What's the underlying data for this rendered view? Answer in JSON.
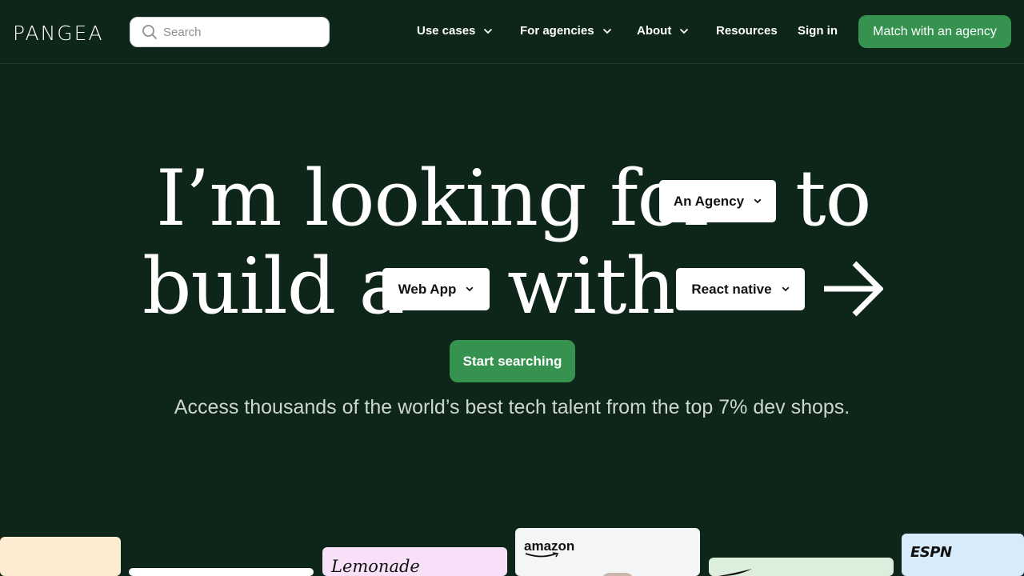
{
  "nav": {
    "logo": "PANGEA",
    "search_placeholder": "Search",
    "items": [
      {
        "label": "Use cases"
      },
      {
        "label": "For agencies"
      },
      {
        "label": "About"
      },
      {
        "label": "Resources"
      },
      {
        "label": "Sign in"
      }
    ],
    "cta_label": "Match with an agency"
  },
  "hero": {
    "line1_text": "I’m looking for",
    "line1_end": "to",
    "line2_text": "build a",
    "line2_mid": "with",
    "dropdown_agency": "An Agency",
    "dropdown_type": "Web App",
    "dropdown_tech": "React native",
    "start_label": "Start searching",
    "subtitle": "Access thousands of the world’s best tech talent from the top 7% dev shops."
  },
  "cards": {
    "lemonade": "Lemonade",
    "amazon": "amazon",
    "espn": "ESPN"
  },
  "colors": {
    "background": "#0e2619",
    "accent": "#36934f"
  }
}
